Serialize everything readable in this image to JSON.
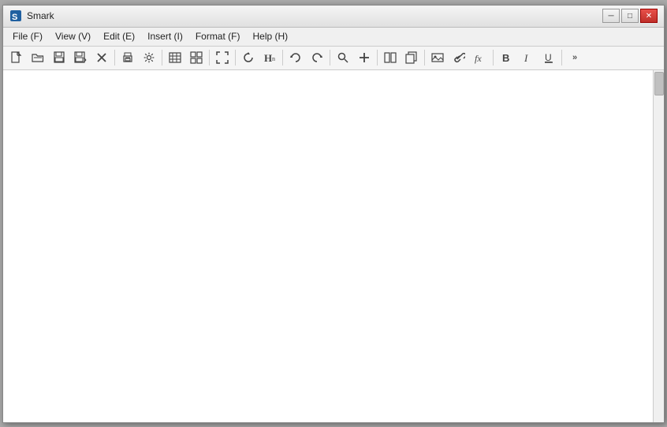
{
  "window": {
    "title": "Smark",
    "icon": "S"
  },
  "titlebar_controls": {
    "minimize_label": "─",
    "maximize_label": "□",
    "close_label": "✕"
  },
  "menubar": {
    "items": [
      {
        "id": "file",
        "label": "File (F)"
      },
      {
        "id": "view",
        "label": "View (V)"
      },
      {
        "id": "edit",
        "label": "Edit (E)"
      },
      {
        "id": "insert",
        "label": "Insert (I)"
      },
      {
        "id": "format",
        "label": "Format (F)"
      },
      {
        "id": "help",
        "label": "Help (H)"
      }
    ]
  },
  "toolbar": {
    "more_label": "»"
  }
}
